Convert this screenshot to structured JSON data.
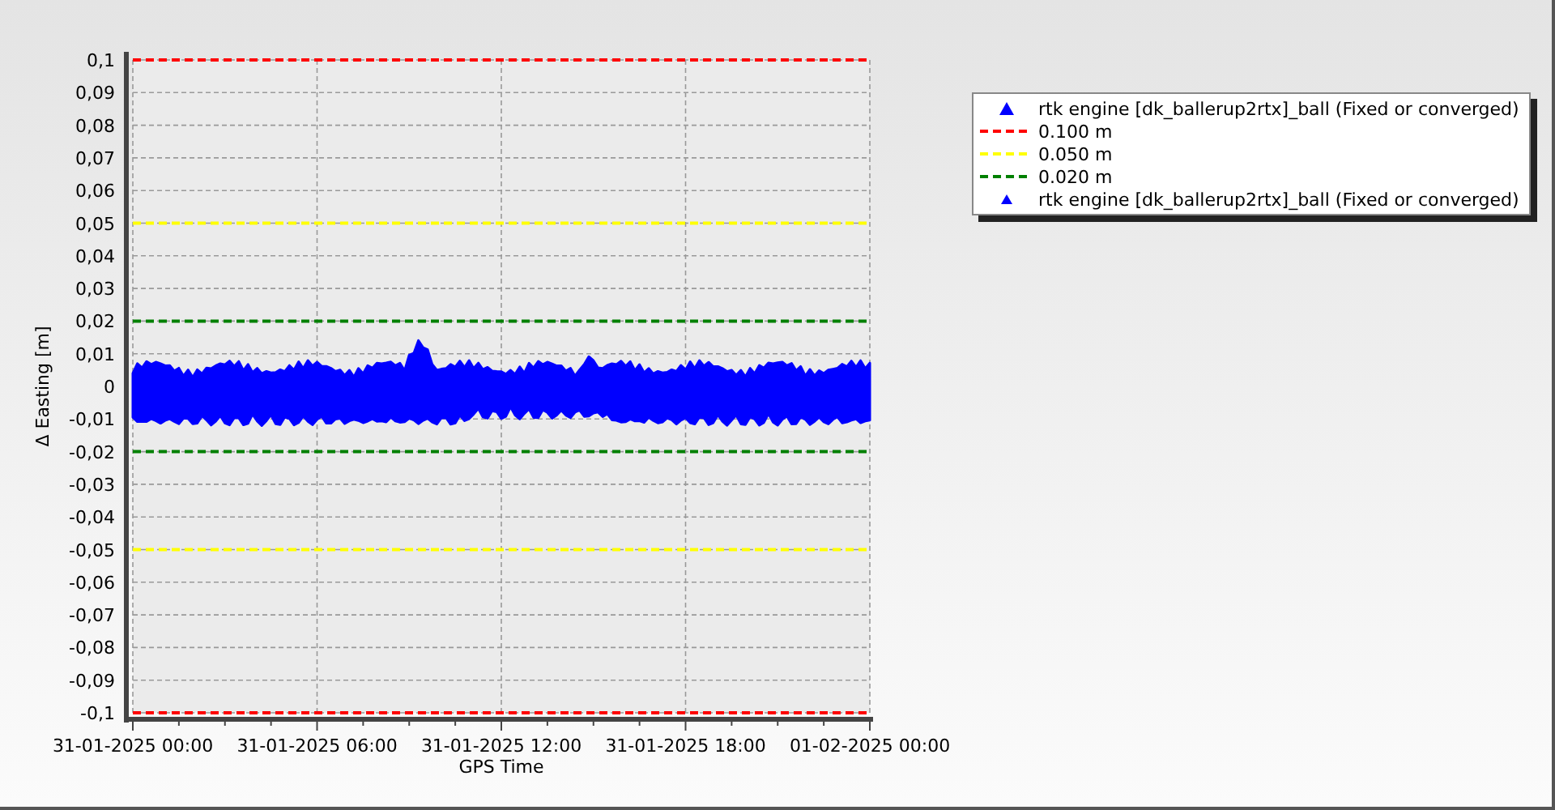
{
  "chart": {
    "chart_data": {
      "type": "line",
      "xlabel": "GPS Time",
      "ylabel": "Δ Easting [m]",
      "grid": true,
      "ylim": [
        -0.1,
        0.1
      ],
      "categories": [
        "31-01-2025 00:00",
        "31-01-2025 06:00",
        "31-01-2025 12:00",
        "31-01-2025 18:00",
        "01-02-2025 00:00"
      ],
      "yticks": [
        {
          "value": 0.1,
          "label": "0,1"
        },
        {
          "value": 0.09,
          "label": "0,09"
        },
        {
          "value": 0.08,
          "label": "0,08"
        },
        {
          "value": 0.07,
          "label": "0,07"
        },
        {
          "value": 0.06,
          "label": "0,06"
        },
        {
          "value": 0.05,
          "label": "0,05"
        },
        {
          "value": 0.04,
          "label": "0,04"
        },
        {
          "value": 0.03,
          "label": "0,03"
        },
        {
          "value": 0.02,
          "label": "0,02"
        },
        {
          "value": 0.01,
          "label": "0,01"
        },
        {
          "value": 0,
          "label": "0"
        },
        {
          "value": -0.01,
          "label": "-0,01"
        },
        {
          "value": -0.02,
          "label": "-0,02"
        },
        {
          "value": -0.03,
          "label": "-0,03"
        },
        {
          "value": -0.04,
          "label": "-0,04"
        },
        {
          "value": -0.05,
          "label": "-0,05"
        },
        {
          "value": -0.06,
          "label": "-0,06"
        },
        {
          "value": -0.07,
          "label": "-0,07"
        },
        {
          "value": -0.08,
          "label": "-0,08"
        },
        {
          "value": -0.09,
          "label": "-0,09"
        },
        {
          "value": -0.1,
          "label": "-0,1"
        }
      ],
      "series": [
        {
          "name": "rtk engine [dk_ballerup2rtx]_ball (Fixed or converged)",
          "marker": "triangle",
          "color": "#0000ff",
          "values": [
            null,
            null,
            null,
            null,
            null
          ]
        },
        {
          "name": "0.100 m",
          "line_style": "dashed",
          "color": "#ff0000",
          "values": [
            0.1,
            0.1,
            0.1,
            0.1,
            0.1
          ]
        },
        {
          "name": "0.050 m",
          "line_style": "dashed",
          "color": "#ffff00",
          "values": [
            0.05,
            0.05,
            0.05,
            0.05,
            0.05
          ]
        },
        {
          "name": "0.020 m",
          "line_style": "dashed",
          "color": "#008000",
          "values": [
            0.02,
            0.02,
            0.02,
            0.02,
            0.02
          ]
        },
        {
          "name": "rtk engine [dk_ballerup2rtx]_ball (Fixed or converged)",
          "marker": "triangle",
          "color": "#0000ff",
          "values": [
            null,
            null,
            null,
            null,
            null
          ]
        }
      ],
      "ref_lines": [
        {
          "axis": "y",
          "value": -0.1,
          "color": "#ff0000",
          "line_style": "dashed"
        },
        {
          "axis": "y",
          "value": -0.05,
          "color": "#ffff00",
          "line_style": "dashed"
        },
        {
          "axis": "y",
          "value": -0.02,
          "color": "#008000",
          "line_style": "dashed"
        }
      ]
    }
  }
}
